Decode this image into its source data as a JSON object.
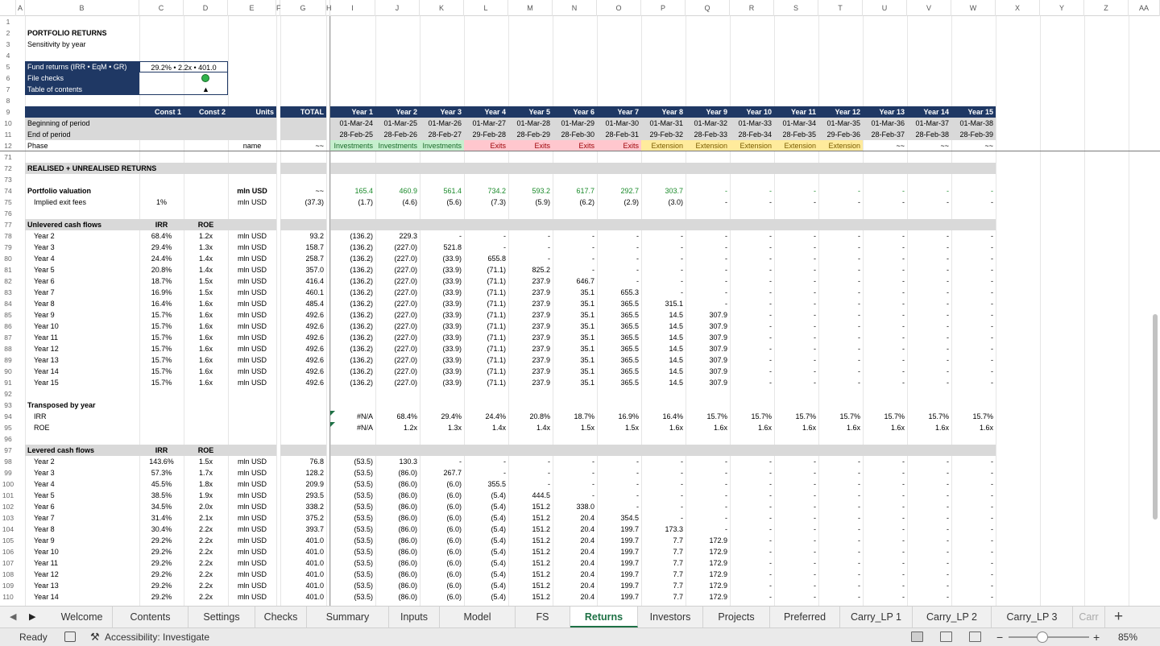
{
  "columns": [
    "A",
    "B",
    "C",
    "D",
    "E",
    "F",
    "G",
    "H",
    "I",
    "J",
    "K",
    "L",
    "M",
    "N",
    "O",
    "P",
    "Q",
    "R",
    "S",
    "T",
    "U",
    "V",
    "W",
    "X",
    "Y",
    "Z",
    "AA"
  ],
  "title": {
    "r2": "PORTFOLIO RETURNS",
    "r3": "Sensitivity by year"
  },
  "summary": {
    "fund_returns_label": "Fund returns (IRR • EqM • GR)",
    "fund_returns_value": "29.2% • 2.2x • 401.0",
    "file_checks_label": "File checks",
    "toc_label": "Table of contents",
    "toc_icon": "▲",
    "check_color": "#2fb24a"
  },
  "header": {
    "const1": "Const 1",
    "const2": "Const 2",
    "units": "Units",
    "total": "TOTAL",
    "years": [
      "Year 1",
      "Year 2",
      "Year 3",
      "Year 4",
      "Year 5",
      "Year 6",
      "Year 7",
      "Year 8",
      "Year 9",
      "Year 10",
      "Year 11",
      "Year 12",
      "Year 13",
      "Year 14",
      "Year 15"
    ]
  },
  "period": {
    "begin_label": "Beginning of period",
    "end_label": "End of period",
    "phase_label": "Phase",
    "phase_units": "name",
    "phase_total": "~~",
    "begin": [
      "01-Mar-24",
      "01-Mar-25",
      "01-Mar-26",
      "01-Mar-27",
      "01-Mar-28",
      "01-Mar-29",
      "01-Mar-30",
      "01-Mar-31",
      "01-Mar-32",
      "01-Mar-33",
      "01-Mar-34",
      "01-Mar-35",
      "01-Mar-36",
      "01-Mar-37",
      "01-Mar-38"
    ],
    "end": [
      "28-Feb-25",
      "28-Feb-26",
      "28-Feb-27",
      "29-Feb-28",
      "28-Feb-29",
      "28-Feb-30",
      "28-Feb-31",
      "29-Feb-32",
      "28-Feb-33",
      "28-Feb-34",
      "28-Feb-35",
      "29-Feb-36",
      "28-Feb-37",
      "28-Feb-38",
      "28-Feb-39"
    ],
    "phase": [
      "Investments",
      "Investments",
      "Investments",
      "Exits",
      "Exits",
      "Exits",
      "Exits",
      "Extension",
      "Extension",
      "Extension",
      "Extension",
      "Extension",
      "~~",
      "~~",
      "~~"
    ]
  },
  "section_realised": "REALISED + UNREALISED RETURNS",
  "valuation": {
    "label": "Portfolio valuation",
    "units": "mln USD",
    "total": "~~",
    "values": [
      "165.4",
      "460.9",
      "561.4",
      "734.2",
      "593.2",
      "617.7",
      "292.7",
      "303.7",
      "-",
      "-",
      "-",
      "-",
      "-",
      "-",
      "-"
    ]
  },
  "exit_fees": {
    "label": "Implied exit fees",
    "const1": "1%",
    "units": "mln USD",
    "total": "(37.3)",
    "values": [
      "(1.7)",
      "(4.6)",
      "(5.6)",
      "(7.3)",
      "(5.9)",
      "(6.2)",
      "(2.9)",
      "(3.0)",
      "-",
      "-",
      "-",
      "-",
      "-",
      "-",
      "-"
    ]
  },
  "unlevered": {
    "label": "Unlevered cash flows",
    "irr_hdr": "IRR",
    "roe_hdr": "ROE",
    "units": "mln USD",
    "rows": [
      {
        "rn": 78,
        "name": "Year 2",
        "irr": "68.4%",
        "roe": "1.2x",
        "total": "93.2",
        "v": [
          "(136.2)",
          "229.3",
          "-",
          "-",
          "-",
          "-",
          "-",
          "-",
          "-",
          "-",
          "-",
          "-",
          "-",
          "-",
          "-"
        ]
      },
      {
        "rn": 79,
        "name": "Year 3",
        "irr": "29.4%",
        "roe": "1.3x",
        "total": "158.7",
        "v": [
          "(136.2)",
          "(227.0)",
          "521.8",
          "-",
          "-",
          "-",
          "-",
          "-",
          "-",
          "-",
          "-",
          "-",
          "-",
          "-",
          "-"
        ]
      },
      {
        "rn": 80,
        "name": "Year 4",
        "irr": "24.4%",
        "roe": "1.4x",
        "total": "258.7",
        "v": [
          "(136.2)",
          "(227.0)",
          "(33.9)",
          "655.8",
          "-",
          "-",
          "-",
          "-",
          "-",
          "-",
          "-",
          "-",
          "-",
          "-",
          "-"
        ]
      },
      {
        "rn": 81,
        "name": "Year 5",
        "irr": "20.8%",
        "roe": "1.4x",
        "total": "357.0",
        "v": [
          "(136.2)",
          "(227.0)",
          "(33.9)",
          "(71.1)",
          "825.2",
          "-",
          "-",
          "-",
          "-",
          "-",
          "-",
          "-",
          "-",
          "-",
          "-"
        ]
      },
      {
        "rn": 82,
        "name": "Year 6",
        "irr": "18.7%",
        "roe": "1.5x",
        "total": "416.4",
        "v": [
          "(136.2)",
          "(227.0)",
          "(33.9)",
          "(71.1)",
          "237.9",
          "646.7",
          "-",
          "-",
          "-",
          "-",
          "-",
          "-",
          "-",
          "-",
          "-"
        ]
      },
      {
        "rn": 83,
        "name": "Year 7",
        "irr": "16.9%",
        "roe": "1.5x",
        "total": "460.1",
        "v": [
          "(136.2)",
          "(227.0)",
          "(33.9)",
          "(71.1)",
          "237.9",
          "35.1",
          "655.3",
          "-",
          "-",
          "-",
          "-",
          "-",
          "-",
          "-",
          "-"
        ]
      },
      {
        "rn": 84,
        "name": "Year 8",
        "irr": "16.4%",
        "roe": "1.6x",
        "total": "485.4",
        "v": [
          "(136.2)",
          "(227.0)",
          "(33.9)",
          "(71.1)",
          "237.9",
          "35.1",
          "365.5",
          "315.1",
          "-",
          "-",
          "-",
          "-",
          "-",
          "-",
          "-"
        ]
      },
      {
        "rn": 85,
        "name": "Year 9",
        "irr": "15.7%",
        "roe": "1.6x",
        "total": "492.6",
        "v": [
          "(136.2)",
          "(227.0)",
          "(33.9)",
          "(71.1)",
          "237.9",
          "35.1",
          "365.5",
          "14.5",
          "307.9",
          "-",
          "-",
          "-",
          "-",
          "-",
          "-"
        ]
      },
      {
        "rn": 86,
        "name": "Year 10",
        "irr": "15.7%",
        "roe": "1.6x",
        "total": "492.6",
        "v": [
          "(136.2)",
          "(227.0)",
          "(33.9)",
          "(71.1)",
          "237.9",
          "35.1",
          "365.5",
          "14.5",
          "307.9",
          "-",
          "-",
          "-",
          "-",
          "-",
          "-"
        ]
      },
      {
        "rn": 87,
        "name": "Year 11",
        "irr": "15.7%",
        "roe": "1.6x",
        "total": "492.6",
        "v": [
          "(136.2)",
          "(227.0)",
          "(33.9)",
          "(71.1)",
          "237.9",
          "35.1",
          "365.5",
          "14.5",
          "307.9",
          "-",
          "-",
          "-",
          "-",
          "-",
          "-"
        ]
      },
      {
        "rn": 88,
        "name": "Year 12",
        "irr": "15.7%",
        "roe": "1.6x",
        "total": "492.6",
        "v": [
          "(136.2)",
          "(227.0)",
          "(33.9)",
          "(71.1)",
          "237.9",
          "35.1",
          "365.5",
          "14.5",
          "307.9",
          "-",
          "-",
          "-",
          "-",
          "-",
          "-"
        ]
      },
      {
        "rn": 89,
        "name": "Year 13",
        "irr": "15.7%",
        "roe": "1.6x",
        "total": "492.6",
        "v": [
          "(136.2)",
          "(227.0)",
          "(33.9)",
          "(71.1)",
          "237.9",
          "35.1",
          "365.5",
          "14.5",
          "307.9",
          "-",
          "-",
          "-",
          "-",
          "-",
          "-"
        ]
      },
      {
        "rn": 90,
        "name": "Year 14",
        "irr": "15.7%",
        "roe": "1.6x",
        "total": "492.6",
        "v": [
          "(136.2)",
          "(227.0)",
          "(33.9)",
          "(71.1)",
          "237.9",
          "35.1",
          "365.5",
          "14.5",
          "307.9",
          "-",
          "-",
          "-",
          "-",
          "-",
          "-"
        ]
      },
      {
        "rn": 91,
        "name": "Year 15",
        "irr": "15.7%",
        "roe": "1.6x",
        "total": "492.6",
        "v": [
          "(136.2)",
          "(227.0)",
          "(33.9)",
          "(71.1)",
          "237.9",
          "35.1",
          "365.5",
          "14.5",
          "307.9",
          "-",
          "-",
          "-",
          "-",
          "-",
          "-"
        ]
      }
    ]
  },
  "transposed": {
    "label": "Transposed by year",
    "irr_label": "IRR",
    "roe_label": "ROE",
    "irr": [
      "#N/A",
      "68.4%",
      "29.4%",
      "24.4%",
      "20.8%",
      "18.7%",
      "16.9%",
      "16.4%",
      "15.7%",
      "15.7%",
      "15.7%",
      "15.7%",
      "15.7%",
      "15.7%",
      "15.7%"
    ],
    "roe": [
      "#N/A",
      "1.2x",
      "1.3x",
      "1.4x",
      "1.4x",
      "1.5x",
      "1.5x",
      "1.6x",
      "1.6x",
      "1.6x",
      "1.6x",
      "1.6x",
      "1.6x",
      "1.6x",
      "1.6x"
    ]
  },
  "levered": {
    "label": "Levered cash flows",
    "irr_hdr": "IRR",
    "roe_hdr": "ROE",
    "units": "mln USD",
    "rows": [
      {
        "rn": 98,
        "name": "Year 2",
        "irr": "143.6%",
        "roe": "1.5x",
        "total": "76.8",
        "v": [
          "(53.5)",
          "130.3",
          "-",
          "-",
          "-",
          "-",
          "-",
          "-",
          "-",
          "-",
          "-",
          "-",
          "-",
          "-",
          "-"
        ]
      },
      {
        "rn": 99,
        "name": "Year 3",
        "irr": "57.3%",
        "roe": "1.7x",
        "total": "128.2",
        "v": [
          "(53.5)",
          "(86.0)",
          "267.7",
          "-",
          "-",
          "-",
          "-",
          "-",
          "-",
          "-",
          "-",
          "-",
          "-",
          "-",
          "-"
        ]
      },
      {
        "rn": 100,
        "name": "Year 4",
        "irr": "45.5%",
        "roe": "1.8x",
        "total": "209.9",
        "v": [
          "(53.5)",
          "(86.0)",
          "(6.0)",
          "355.5",
          "-",
          "-",
          "-",
          "-",
          "-",
          "-",
          "-",
          "-",
          "-",
          "-",
          "-"
        ]
      },
      {
        "rn": 101,
        "name": "Year 5",
        "irr": "38.5%",
        "roe": "1.9x",
        "total": "293.5",
        "v": [
          "(53.5)",
          "(86.0)",
          "(6.0)",
          "(5.4)",
          "444.5",
          "-",
          "-",
          "-",
          "-",
          "-",
          "-",
          "-",
          "-",
          "-",
          "-"
        ]
      },
      {
        "rn": 102,
        "name": "Year 6",
        "irr": "34.5%",
        "roe": "2.0x",
        "total": "338.2",
        "v": [
          "(53.5)",
          "(86.0)",
          "(6.0)",
          "(5.4)",
          "151.2",
          "338.0",
          "-",
          "-",
          "-",
          "-",
          "-",
          "-",
          "-",
          "-",
          "-"
        ]
      },
      {
        "rn": 103,
        "name": "Year 7",
        "irr": "31.4%",
        "roe": "2.1x",
        "total": "375.2",
        "v": [
          "(53.5)",
          "(86.0)",
          "(6.0)",
          "(5.4)",
          "151.2",
          "20.4",
          "354.5",
          "-",
          "-",
          "-",
          "-",
          "-",
          "-",
          "-",
          "-"
        ]
      },
      {
        "rn": 104,
        "name": "Year 8",
        "irr": "30.4%",
        "roe": "2.2x",
        "total": "393.7",
        "v": [
          "(53.5)",
          "(86.0)",
          "(6.0)",
          "(5.4)",
          "151.2",
          "20.4",
          "199.7",
          "173.3",
          "-",
          "-",
          "-",
          "-",
          "-",
          "-",
          "-"
        ]
      },
      {
        "rn": 105,
        "name": "Year 9",
        "irr": "29.2%",
        "roe": "2.2x",
        "total": "401.0",
        "v": [
          "(53.5)",
          "(86.0)",
          "(6.0)",
          "(5.4)",
          "151.2",
          "20.4",
          "199.7",
          "7.7",
          "172.9",
          "-",
          "-",
          "-",
          "-",
          "-",
          "-"
        ]
      },
      {
        "rn": 106,
        "name": "Year 10",
        "irr": "29.2%",
        "roe": "2.2x",
        "total": "401.0",
        "v": [
          "(53.5)",
          "(86.0)",
          "(6.0)",
          "(5.4)",
          "151.2",
          "20.4",
          "199.7",
          "7.7",
          "172.9",
          "-",
          "-",
          "-",
          "-",
          "-",
          "-"
        ]
      },
      {
        "rn": 107,
        "name": "Year 11",
        "irr": "29.2%",
        "roe": "2.2x",
        "total": "401.0",
        "v": [
          "(53.5)",
          "(86.0)",
          "(6.0)",
          "(5.4)",
          "151.2",
          "20.4",
          "199.7",
          "7.7",
          "172.9",
          "-",
          "-",
          "-",
          "-",
          "-",
          "-"
        ]
      },
      {
        "rn": 108,
        "name": "Year 12",
        "irr": "29.2%",
        "roe": "2.2x",
        "total": "401.0",
        "v": [
          "(53.5)",
          "(86.0)",
          "(6.0)",
          "(5.4)",
          "151.2",
          "20.4",
          "199.7",
          "7.7",
          "172.9",
          "-",
          "-",
          "-",
          "-",
          "-",
          "-"
        ]
      },
      {
        "rn": 109,
        "name": "Year 13",
        "irr": "29.2%",
        "roe": "2.2x",
        "total": "401.0",
        "v": [
          "(53.5)",
          "(86.0)",
          "(6.0)",
          "(5.4)",
          "151.2",
          "20.4",
          "199.7",
          "7.7",
          "172.9",
          "-",
          "-",
          "-",
          "-",
          "-",
          "-"
        ]
      },
      {
        "rn": 110,
        "name": "Year 14",
        "irr": "29.2%",
        "roe": "2.2x",
        "total": "401.0",
        "v": [
          "(53.5)",
          "(86.0)",
          "(6.0)",
          "(5.4)",
          "151.2",
          "20.4",
          "199.7",
          "7.7",
          "172.9",
          "-",
          "-",
          "-",
          "-",
          "-",
          "-"
        ]
      }
    ]
  },
  "row_numbers": {
    "r71": "71",
    "r72": "72",
    "r73": "73",
    "r74": "74",
    "r75": "75",
    "r76": "76",
    "r77": "77",
    "r92": "92",
    "r93": "93",
    "r94": "94",
    "r95": "95",
    "r96": "96",
    "r97": "97"
  },
  "tabs": [
    "Welcome",
    "Contents",
    "Settings",
    "Checks",
    "Summary",
    "Inputs",
    "Model",
    "FS",
    "Returns",
    "Investors",
    "Projects",
    "Preferred",
    "Carry_LP 1",
    "Carry_LP 2",
    "Carry_LP 3",
    "Carr"
  ],
  "active_tab": "Returns",
  "status": {
    "ready": "Ready",
    "accessibility": "Accessibility: Investigate",
    "zoom": "85%",
    "zoom_level": 0.85
  },
  "colors": {
    "navy": "#1f3864",
    "grey_band": "#d9d9d9",
    "inv": "#c6efce",
    "exit": "#ffc7ce",
    "ext": "#ffeb9c",
    "green_text": "#1a8a2a",
    "active_tab": "#1e7145"
  }
}
